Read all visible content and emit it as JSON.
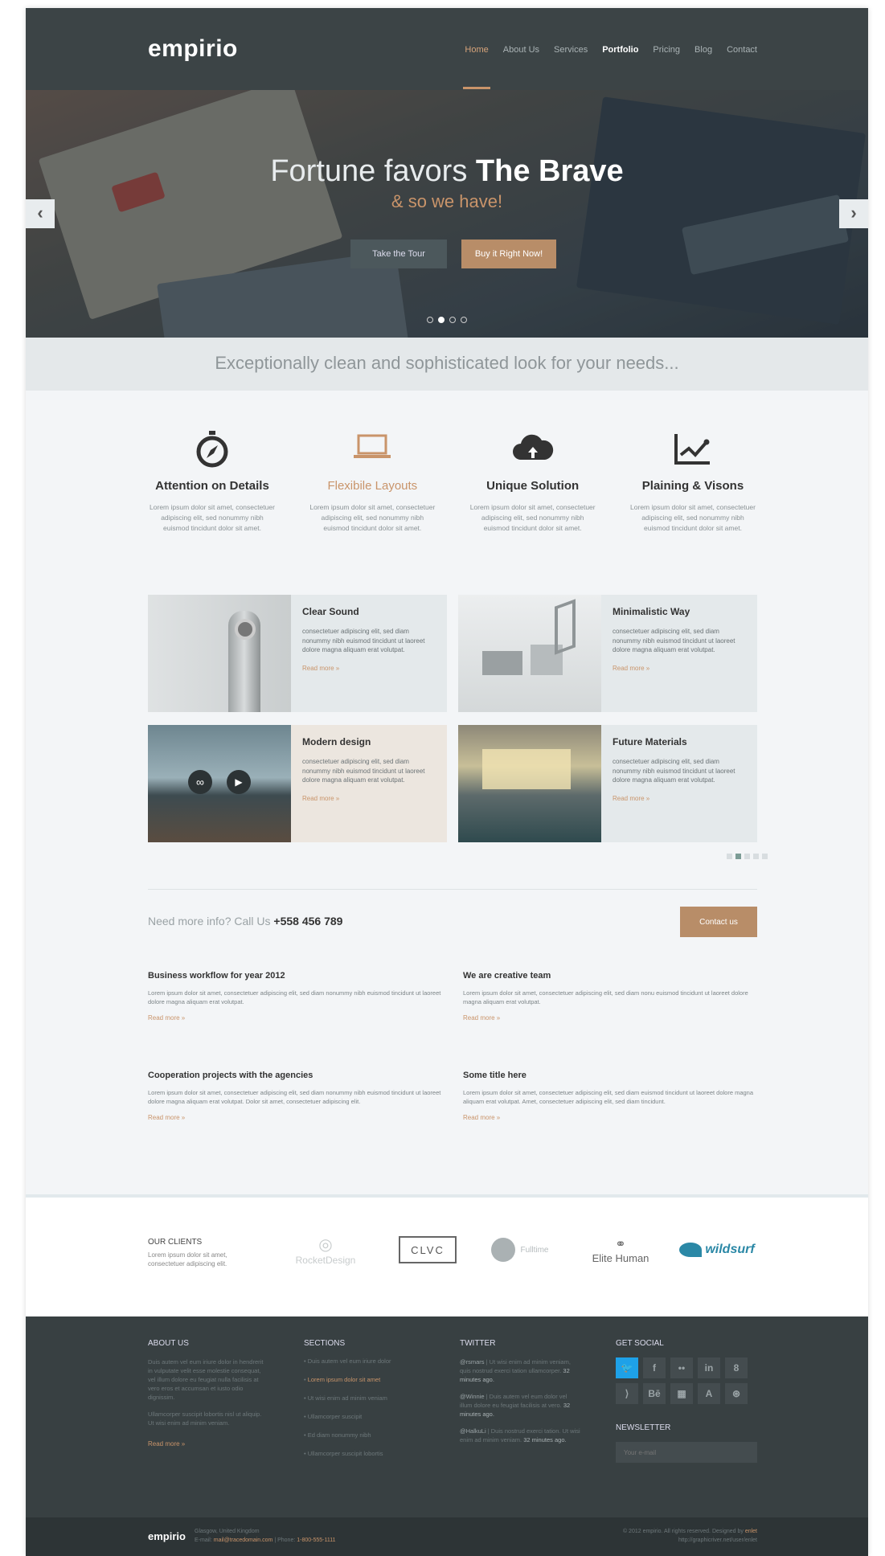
{
  "header": {
    "logo": "empirio",
    "nav": [
      "Home",
      "About Us",
      "Services",
      "Portfolio",
      "Pricing",
      "Blog",
      "Contact"
    ],
    "active": "Home",
    "highlighted": "Portfolio"
  },
  "hero": {
    "title_prefix": "Fortune favors",
    "title_bold": "The Brave",
    "subtitle": "& so we have!",
    "tour_label": "Take the Tour",
    "buy_label": "Buy it Right Now!",
    "prev_icon": "chevron-left-icon",
    "next_icon": "chevron-right-icon",
    "dots": 4,
    "active_dot": 2
  },
  "tagline": "Exceptionally clean and sophisticated look for your needs...",
  "features": [
    {
      "icon": "compass-icon",
      "title": "Attention on Details",
      "text": "Lorem ipsum dolor sit amet, consectetuer adipiscing elit, sed nonummy nibh euismod tincidunt dolor sit amet."
    },
    {
      "icon": "laptop-icon",
      "title": "Flexibile Layouts",
      "text": "Lorem ipsum dolor sit amet, consectetuer adipiscing elit, sed nonummy nibh euismod tincidunt dolor sit amet."
    },
    {
      "icon": "cloud-upload-icon",
      "title": "Unique Solution",
      "text": "Lorem ipsum dolor sit amet, consectetuer adipiscing elit, sed nonummy nibh euismod tincidunt dolor sit amet."
    },
    {
      "icon": "line-chart-icon",
      "title": "Plaining & Visons",
      "text": "Lorem ipsum dolor sit amet, consectetuer adipiscing elit, sed nonummy nibh euismod tincidunt dolor sit amet."
    }
  ],
  "portfolio": [
    {
      "title": "Clear Sound",
      "text": "consectetuer adipiscing elit, sed diam nonummy nibh euismod tincidunt ut laoreet dolore magna aliquam erat volutpat.",
      "more": "Read more »"
    },
    {
      "title": "Minimalistic Way",
      "text": "consectetuer adipiscing elit, sed diam nonummy nibh euismod tincidunt ut laoreet dolore magna aliquam erat volutpat.",
      "more": "Read more »"
    },
    {
      "title": "Modern design",
      "text": "consectetuer adipiscing elit, sed diam nonummy nibh euismod tincidunt ut laoreet dolore magna aliquam erat volutpat.",
      "more": "Read more »"
    },
    {
      "title": "Future Materials",
      "text": "consectetuer adipiscing elit, sed diam nonummy nibh euismod tincidunt ut laoreet dolore magna aliquam erat volutpat.",
      "more": "Read more »"
    }
  ],
  "callbar": {
    "text": "Need more info? Call Us",
    "phone": "+558 456 789",
    "button": "Contact us"
  },
  "articles": [
    {
      "title": "Business workflow for year 2012",
      "text": "Lorem ipsum dolor sit amet, consectetuer adipiscing elit, sed diam nonummy nibh euismod tincidunt ut laoreet dolore magna aliquam erat volutpat.",
      "more": "Read more »"
    },
    {
      "title": "We are creative team",
      "text": "Lorem ipsum dolor sit amet, consectetuer adipiscing elit, sed diam nonu euismod tincidunt ut laoreet dolore magna aliquam erat volutpat.",
      "more": "Read more »"
    },
    {
      "title": "Cooperation projects with the agencies",
      "text": "Lorem ipsum dolor sit amet, consectetuer adipiscing elit, sed diam nonummy nibh euismod tincidunt ut laoreet dolore magna aliquam erat volutpat. Dolor sit amet, consectetuer adipiscing elit.",
      "more": "Read more »"
    },
    {
      "title": "Some title here",
      "text": "Lorem ipsum dolor sit amet, consectetuer adipiscing elit, sed diam euismod tincidunt ut laoreet dolore magna aliquam erat volutpat. Amet, consectetuer adipiscing elit, sed diam tincidunt.",
      "more": "Read more »"
    }
  ],
  "clients": {
    "title": "OUR CLIENTS",
    "desc": "Lorem ipsum dolor sit amet, consectetuer adipiscing elit.",
    "logos": [
      "RocketDesign",
      "CLVC",
      "Fulltime",
      "Elite Human",
      "wildsurf"
    ]
  },
  "footer": {
    "about_title": "ABOUT US",
    "about_text1": "Duis autem vel eum iriure dolor in hendrerit in vulputate velit esse molestie consequat, vel illum dolore eu feugiat nulla facilisis at vero eros et accumsan et iusto odio dignissim.",
    "about_text2": "Ullamcorper suscipit lobortis nisl ut aliquip. Ut wisi enim ad minim veniam.",
    "about_more": "Read more »",
    "sections_title": "SECTIONS",
    "sections": [
      "Duis autem vel eum iriure dolor",
      "Lorem ipsum dolor sit amet",
      "Ut wisi enim ad minim veniam",
      "Ullamcorper suscipit",
      "Ed diam nonummy nibh",
      "Ullamcorper suscipit lobortis"
    ],
    "twitter_title": "TWITTER",
    "tweets": [
      {
        "user": "@rsmars",
        "text": "Ut wisi enim ad minim veniam, quis nostrud exerci tation ullamcorper.",
        "time": "32 minutes ago."
      },
      {
        "user": "@Winnie",
        "text": "Duis autem vel eum dolor vel illum dolore eu feugiat facilisis at vero.",
        "time": "32 minutes ago."
      },
      {
        "user": "@HalkuLi",
        "text": "Duis nostrud exerci tation. Ut wisi enim ad minim veniam.",
        "time": "32 minutes ago."
      }
    ],
    "social_title": "GET SOCIAL",
    "social": [
      "twitter-icon",
      "facebook-icon",
      "flickr-icon",
      "linkedin-icon",
      "skype-icon",
      "rss-icon",
      "behance-icon",
      "windows-icon",
      "appstore-icon",
      "dribbble-icon"
    ],
    "social_glyphs": [
      "🐦",
      "f",
      "••",
      "in",
      "8",
      "⟩",
      "Bē",
      "▦",
      "A",
      "⊛"
    ],
    "newsletter_title": "NEWSLETTER",
    "newsletter_placeholder": "Your e-mail"
  },
  "bottom": {
    "logo": "empirio",
    "address": "Glasgow, United Kingdom",
    "email_label": "E-mail:",
    "email": "mail@tracedomain.com",
    "phone_label": "Phone:",
    "phone": "1-800-555-1111",
    "copyright": "© 2012 empirio. All rights reserved. Designed by",
    "designer": "enlet",
    "url": "http://graphicriver.net/user/enlet"
  }
}
